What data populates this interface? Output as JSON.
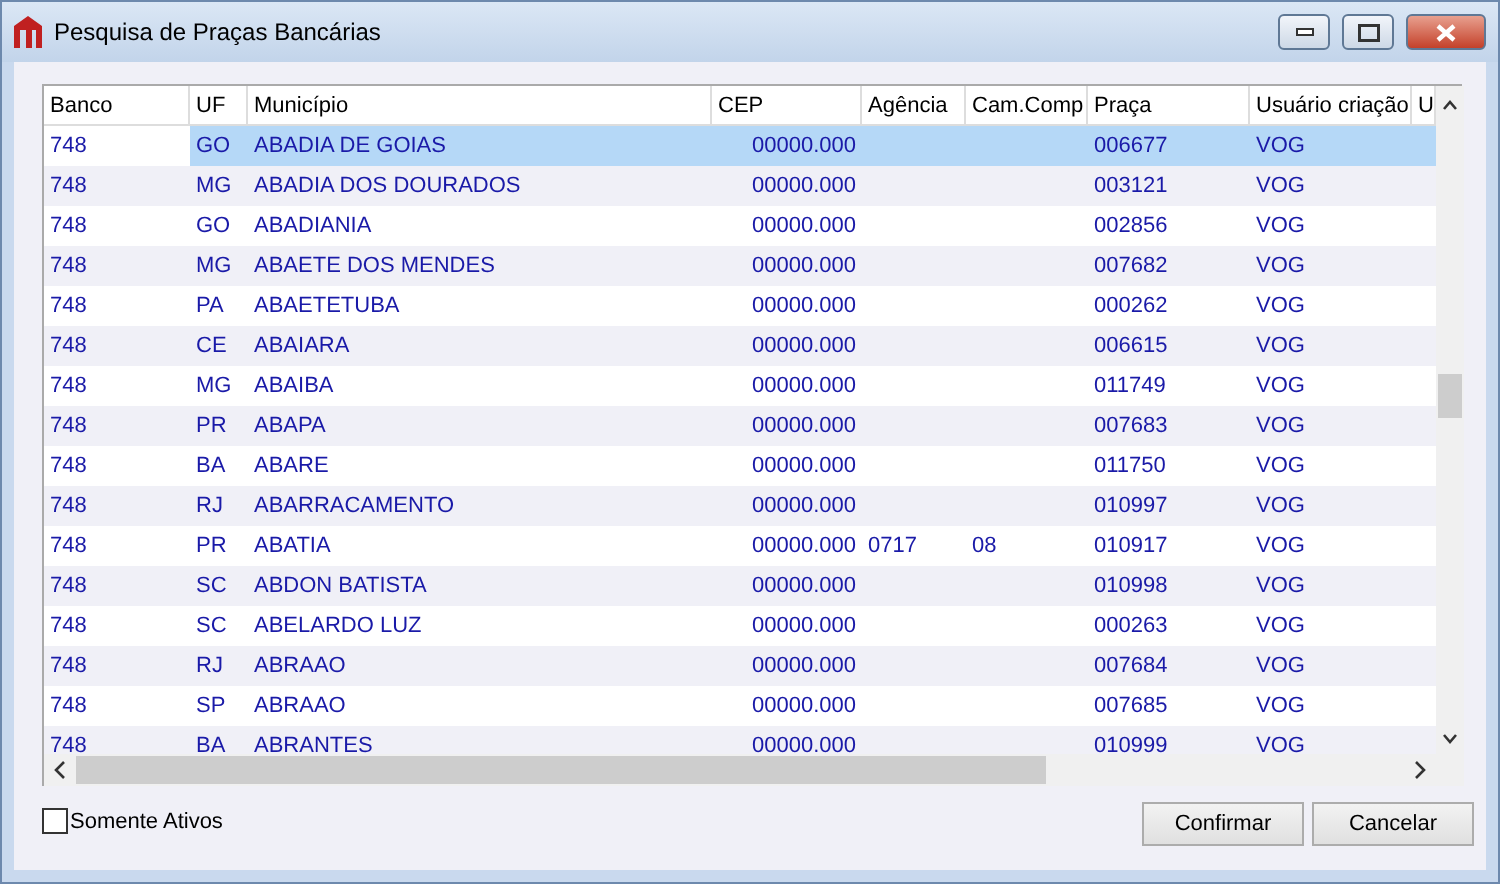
{
  "window": {
    "title": "Pesquisa de Praças Bancárias"
  },
  "table": {
    "columns": [
      "Banco",
      "UF",
      "Município",
      "CEP",
      "Agência",
      "Cam.Comp",
      "Praça",
      "Usuário criação",
      "U"
    ],
    "rows": [
      {
        "cells": [
          "748",
          "GO",
          "ABADIA DE GOIAS",
          "00000.000",
          "",
          "",
          "006677",
          "VOG"
        ],
        "selected": true
      },
      {
        "cells": [
          "748",
          "MG",
          "ABADIA DOS DOURADOS",
          "00000.000",
          "",
          "",
          "003121",
          "VOG"
        ],
        "selected": false
      },
      {
        "cells": [
          "748",
          "GO",
          "ABADIANIA",
          "00000.000",
          "",
          "",
          "002856",
          "VOG"
        ],
        "selected": false
      },
      {
        "cells": [
          "748",
          "MG",
          "ABAETE DOS MENDES",
          "00000.000",
          "",
          "",
          "007682",
          "VOG"
        ],
        "selected": false
      },
      {
        "cells": [
          "748",
          "PA",
          "ABAETETUBA",
          "00000.000",
          "",
          "",
          "000262",
          "VOG"
        ],
        "selected": false
      },
      {
        "cells": [
          "748",
          "CE",
          "ABAIARA",
          "00000.000",
          "",
          "",
          "006615",
          "VOG"
        ],
        "selected": false
      },
      {
        "cells": [
          "748",
          "MG",
          "ABAIBA",
          "00000.000",
          "",
          "",
          "011749",
          "VOG"
        ],
        "selected": false
      },
      {
        "cells": [
          "748",
          "PR",
          "ABAPA",
          "00000.000",
          "",
          "",
          "007683",
          "VOG"
        ],
        "selected": false
      },
      {
        "cells": [
          "748",
          "BA",
          "ABARE",
          "00000.000",
          "",
          "",
          "011750",
          "VOG"
        ],
        "selected": false
      },
      {
        "cells": [
          "748",
          "RJ",
          "ABARRACAMENTO",
          "00000.000",
          "",
          "",
          "010997",
          "VOG"
        ],
        "selected": false
      },
      {
        "cells": [
          "748",
          "PR",
          "ABATIA",
          "00000.000",
          "0717",
          "08",
          "010917",
          "VOG"
        ],
        "selected": false
      },
      {
        "cells": [
          "748",
          "SC",
          "ABDON BATISTA",
          "00000.000",
          "",
          "",
          "010998",
          "VOG"
        ],
        "selected": false
      },
      {
        "cells": [
          "748",
          "SC",
          "ABELARDO LUZ",
          "00000.000",
          "",
          "",
          "000263",
          "VOG"
        ],
        "selected": false
      },
      {
        "cells": [
          "748",
          "RJ",
          "ABRAAO",
          "00000.000",
          "",
          "",
          "007684",
          "VOG"
        ],
        "selected": false
      },
      {
        "cells": [
          "748",
          "SP",
          "ABRAAO",
          "00000.000",
          "",
          "",
          "007685",
          "VOG"
        ],
        "selected": false
      },
      {
        "cells": [
          "748",
          "BA",
          "ABRANTES",
          "00000.000",
          "",
          "",
          "010999",
          "VOG"
        ],
        "selected": false
      }
    ]
  },
  "filter": {
    "label": "Somente Ativos",
    "checked": false
  },
  "buttons": [
    "Confirmar",
    "Cancelar"
  ]
}
